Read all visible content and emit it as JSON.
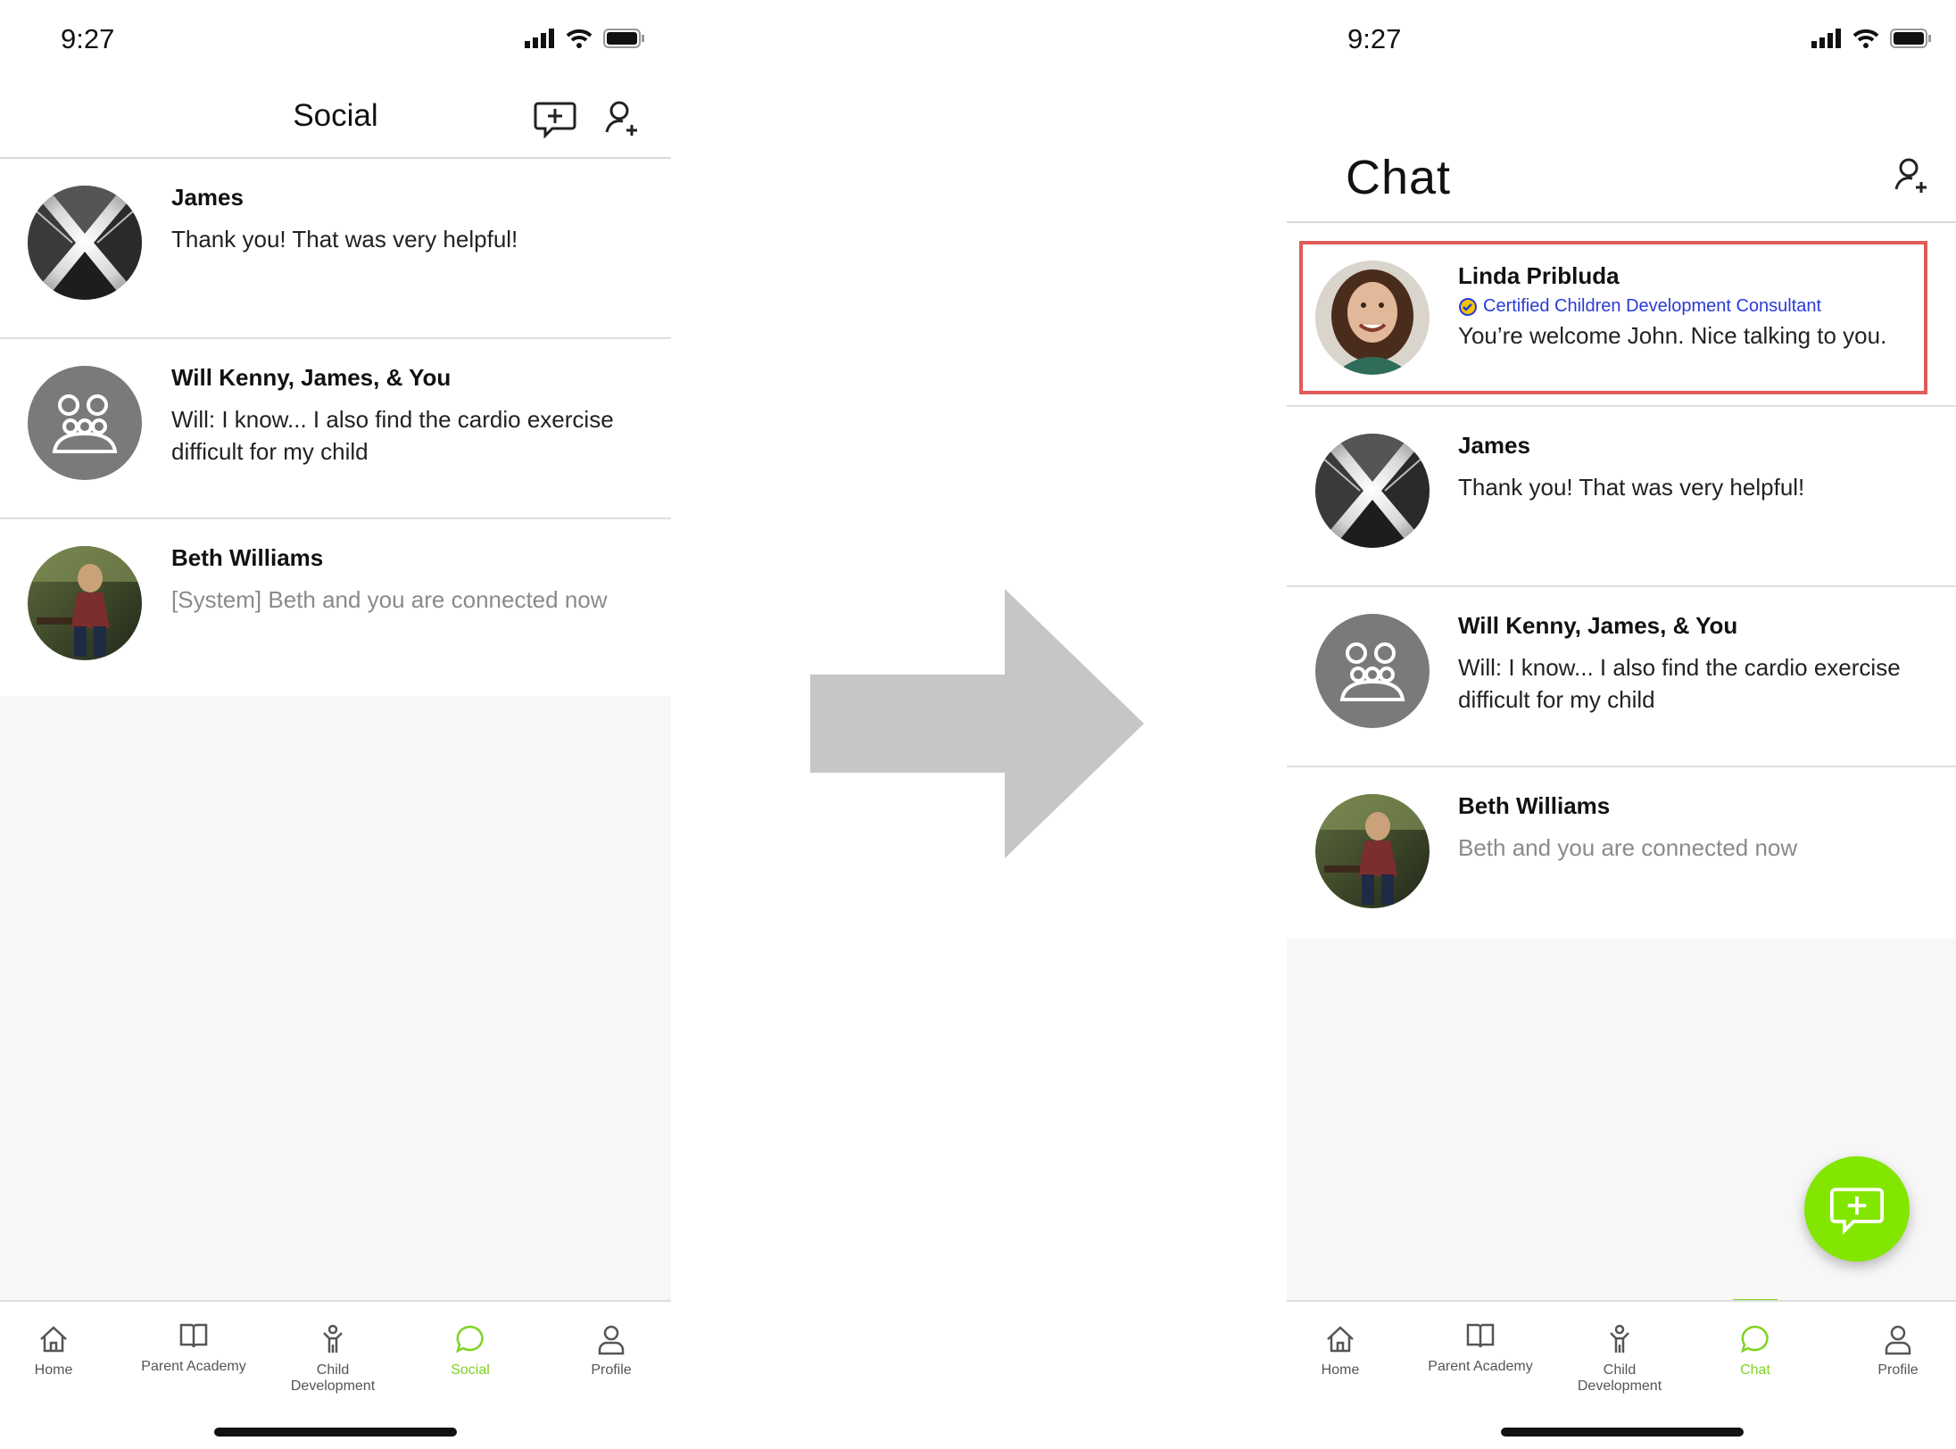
{
  "colors": {
    "accent": "#7ed321",
    "fab": "#82e600",
    "credential": "#2a3bd6",
    "highlight": "#e05b5b",
    "arrow": "#c6c6c6"
  },
  "left_screen": {
    "status_time": "9:27",
    "title": "Social",
    "conversations": [
      {
        "name": "James",
        "message": "Thank you! That was very helpful!",
        "avatar": "skyscraper-photo",
        "system": false
      },
      {
        "name": "Will Kenny, James, & You",
        "message": "Will: I know... I also find the cardio exercise difficult for my child",
        "avatar": "group-chat-icon",
        "system": false
      },
      {
        "name": "Beth Williams",
        "message": "[System] Beth and you are connected now",
        "avatar": "woman-in-park-photo",
        "system": true
      }
    ],
    "tabs": [
      {
        "label": "Home",
        "icon": "home-icon",
        "active": false
      },
      {
        "label": "Parent Academy",
        "icon": "book-icon",
        "active": false
      },
      {
        "label": "Child Development",
        "icon": "child-icon",
        "active": false
      },
      {
        "label": "Social",
        "icon": "chat-bubble-icon",
        "active": true
      },
      {
        "label": "Profile",
        "icon": "person-icon",
        "active": false
      }
    ]
  },
  "right_screen": {
    "status_time": "9:27",
    "title": "Chat",
    "conversations": [
      {
        "name": "Linda Pribluda",
        "credential": "Certified Children Development Consultant",
        "message": "You’re welcome John. Nice talking to you.",
        "avatar": "smiling-woman-photo",
        "highlighted": true
      },
      {
        "name": "James",
        "message": "Thank you! That was very helpful!",
        "avatar": "skyscraper-photo"
      },
      {
        "name": "Will Kenny, James, & You",
        "message": "Will: I know... I also find the cardio exercise difficult for my child",
        "avatar": "group-chat-icon"
      },
      {
        "name": "Beth Williams",
        "message": "Beth and you are connected now",
        "avatar": "woman-in-park-photo",
        "system": true
      }
    ],
    "tabs": [
      {
        "label": "Home",
        "icon": "home-icon",
        "active": false
      },
      {
        "label": "Parent Academy",
        "icon": "book-icon",
        "active": false
      },
      {
        "label": "Child Development",
        "icon": "child-icon",
        "active": false
      },
      {
        "label": "Chat",
        "icon": "chat-bubble-icon",
        "active": true
      },
      {
        "label": "Profile",
        "icon": "person-icon",
        "active": false
      }
    ]
  }
}
